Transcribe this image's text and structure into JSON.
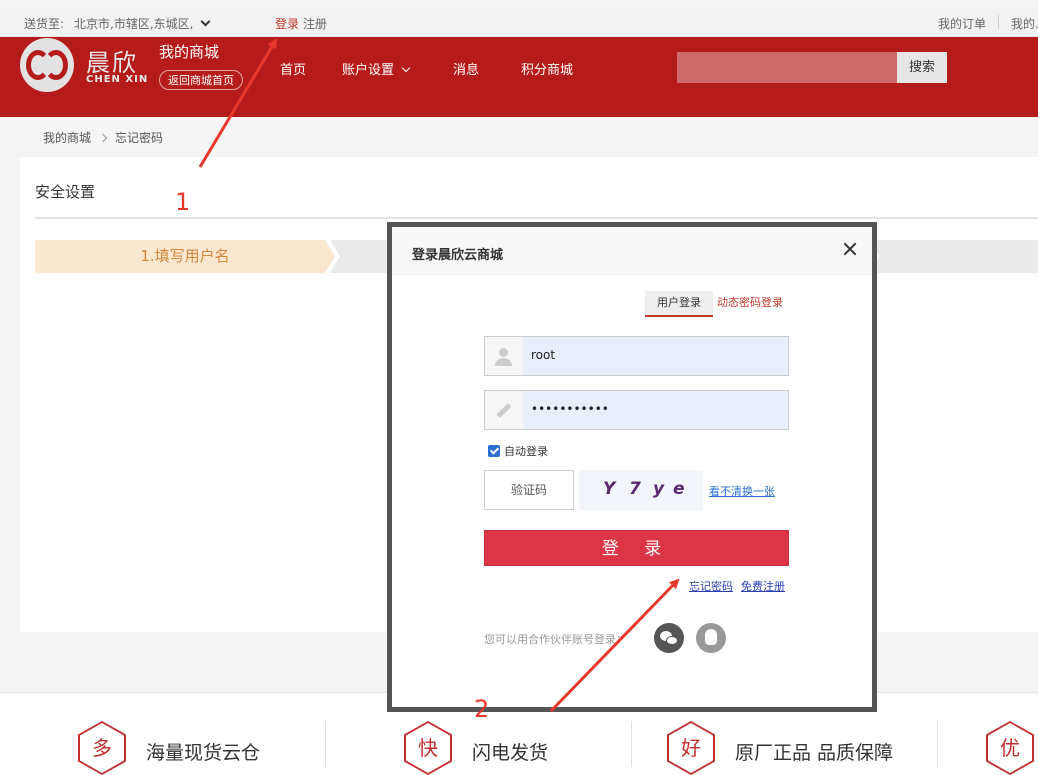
{
  "topbar": {
    "ship_label": "送货至:",
    "ship_value": "北京市,市辖区,东城区,",
    "login": "登录",
    "register": "注册",
    "my_orders": "我的订单",
    "my_more": "我的..."
  },
  "header": {
    "logo_cn": "晨欣",
    "logo_en": "CHEN XIN",
    "mall_title": "我的商城",
    "back_home": "返回商城首页",
    "nav": [
      "首页",
      "账户设置",
      "消息",
      "积分商城"
    ],
    "search_button": "搜索",
    "search_value": ""
  },
  "breadcrumb": [
    "我的商城",
    "忘记密码"
  ],
  "main": {
    "section_title": "安全设置",
    "step1": "1.填写用户名"
  },
  "modal": {
    "title": "登录晨欣云商城",
    "tab_user": "用户登录",
    "tab_dynamic": "动态密码登录",
    "username": "root",
    "password": "•••••••••••",
    "remember": "自动登录",
    "captcha_placeholder": "验证码",
    "captcha_chars": [
      "Y",
      "7",
      "y",
      "e"
    ],
    "captcha_refresh": "看不清换一张",
    "login_button": "登 录",
    "forgot": "忘记密码",
    "free_register": "免费注册",
    "partner_text": "您可以用合作伙伴账号登录："
  },
  "features": [
    {
      "icon": "多",
      "text": "海量现货云仓"
    },
    {
      "icon": "快",
      "text": "闪电发货"
    },
    {
      "icon": "好",
      "text": "原厂正品 品质保障"
    },
    {
      "icon": "优",
      "text": ""
    }
  ],
  "annotations": [
    "1",
    "2"
  ],
  "colors": {
    "brand_red": "#b51b1b",
    "button_red": "#dc3545",
    "annotation": "#e8382c"
  }
}
